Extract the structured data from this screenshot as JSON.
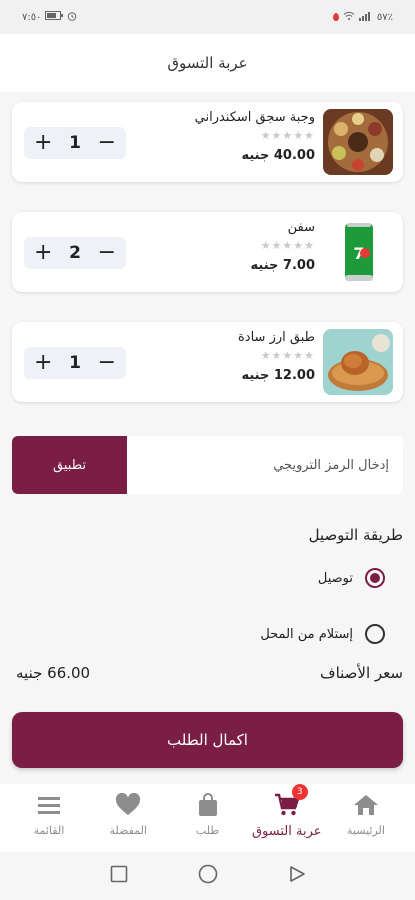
{
  "status_bar": {
    "time": "٧:٥٠",
    "right_text": "٥٧٪"
  },
  "header": {
    "title": "عربة التسوق"
  },
  "cart_items": [
    {
      "name": "وجبة سجق اسكندراني",
      "stars": "★★★★★",
      "price": "40.00",
      "currency": "جنيه",
      "qty": "1"
    },
    {
      "name": "سفن",
      "stars": "★★★★★",
      "price": "7.00",
      "currency": "جنيه",
      "qty": "2"
    },
    {
      "name": "طبق ارز سادة",
      "stars": "★★★★★",
      "price": "12.00",
      "currency": "جنيه",
      "qty": "1"
    }
  ],
  "stepper": {
    "plus": "+",
    "minus": "−"
  },
  "promo": {
    "placeholder": "إدخال الرمز الترويجي",
    "apply_label": "تطبيق"
  },
  "delivery": {
    "title": "طريقة التوصيل",
    "options": [
      {
        "label": "توصيل",
        "selected": true
      },
      {
        "label": "إستلام من المحل",
        "selected": false
      }
    ]
  },
  "summary": {
    "label": "سعر الأصناف",
    "value": "66.00",
    "currency": "جنيه"
  },
  "checkout": {
    "label": "اكمال الطلب"
  },
  "nav": {
    "items": [
      {
        "label": "القائمة",
        "icon": "menu-icon"
      },
      {
        "label": "المفضلة",
        "icon": "heart-icon"
      },
      {
        "label": "طلب",
        "icon": "bag-icon"
      },
      {
        "label": "عربة التسوق",
        "icon": "cart-icon",
        "badge": "3"
      },
      {
        "label": "الرئيسية",
        "icon": "home-icon"
      }
    ]
  },
  "colors": {
    "accent": "#7b1e44",
    "badge": "#e33333"
  }
}
